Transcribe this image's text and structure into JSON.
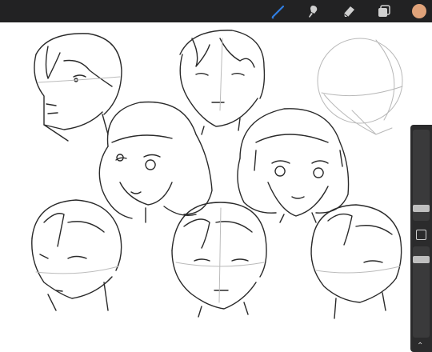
{
  "toolbar": {
    "tools": [
      {
        "name": "brush",
        "icon": "brush-icon",
        "active": true
      },
      {
        "name": "smudge",
        "icon": "smudge-icon",
        "active": false
      },
      {
        "name": "eraser",
        "icon": "eraser-icon",
        "active": false
      },
      {
        "name": "layers",
        "icon": "layers-icon",
        "active": false
      }
    ],
    "current_color": "#e0a37a"
  },
  "sidebar": {
    "brush_size_level": 0.35,
    "opacity_level": 0.6
  },
  "colors": {
    "toolbar_bg": "#222223",
    "accent_blue": "#2f7de1",
    "icon_gray": "#d0d0d0",
    "sidebar_bg": "#2b2b2c"
  }
}
